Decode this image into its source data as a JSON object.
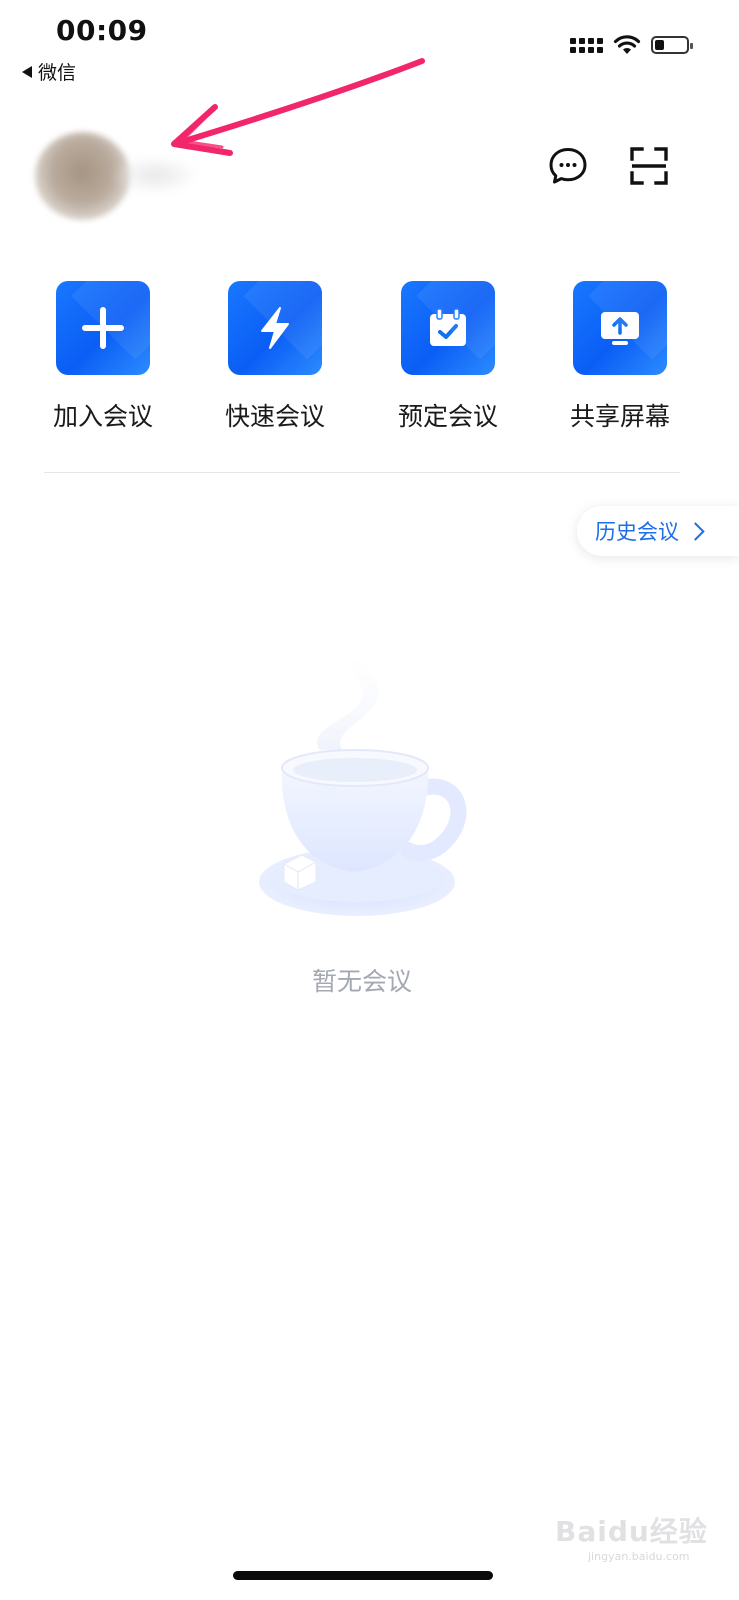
{
  "status_bar": {
    "time": "00:09",
    "back_label": "微信"
  },
  "header": {
    "chat_icon": "chat-bubble-icon",
    "scan_icon": "scan-icon"
  },
  "actions": [
    {
      "label": "加入会议",
      "icon": "plus-icon"
    },
    {
      "label": "快速会议",
      "icon": "lightning-icon"
    },
    {
      "label": "预定会议",
      "icon": "calendar-check-icon"
    },
    {
      "label": "共享屏幕",
      "icon": "screen-share-icon"
    }
  ],
  "history_button": {
    "label": "历史会议"
  },
  "empty_state": {
    "text": "暂无会议"
  },
  "watermark": {
    "text": "Baidu经验",
    "sub": "jingyan.baidu.com"
  },
  "colors": {
    "accent": "#1c6fe8",
    "tile": "#1978ff",
    "annotation_arrow": "#f2266b"
  }
}
